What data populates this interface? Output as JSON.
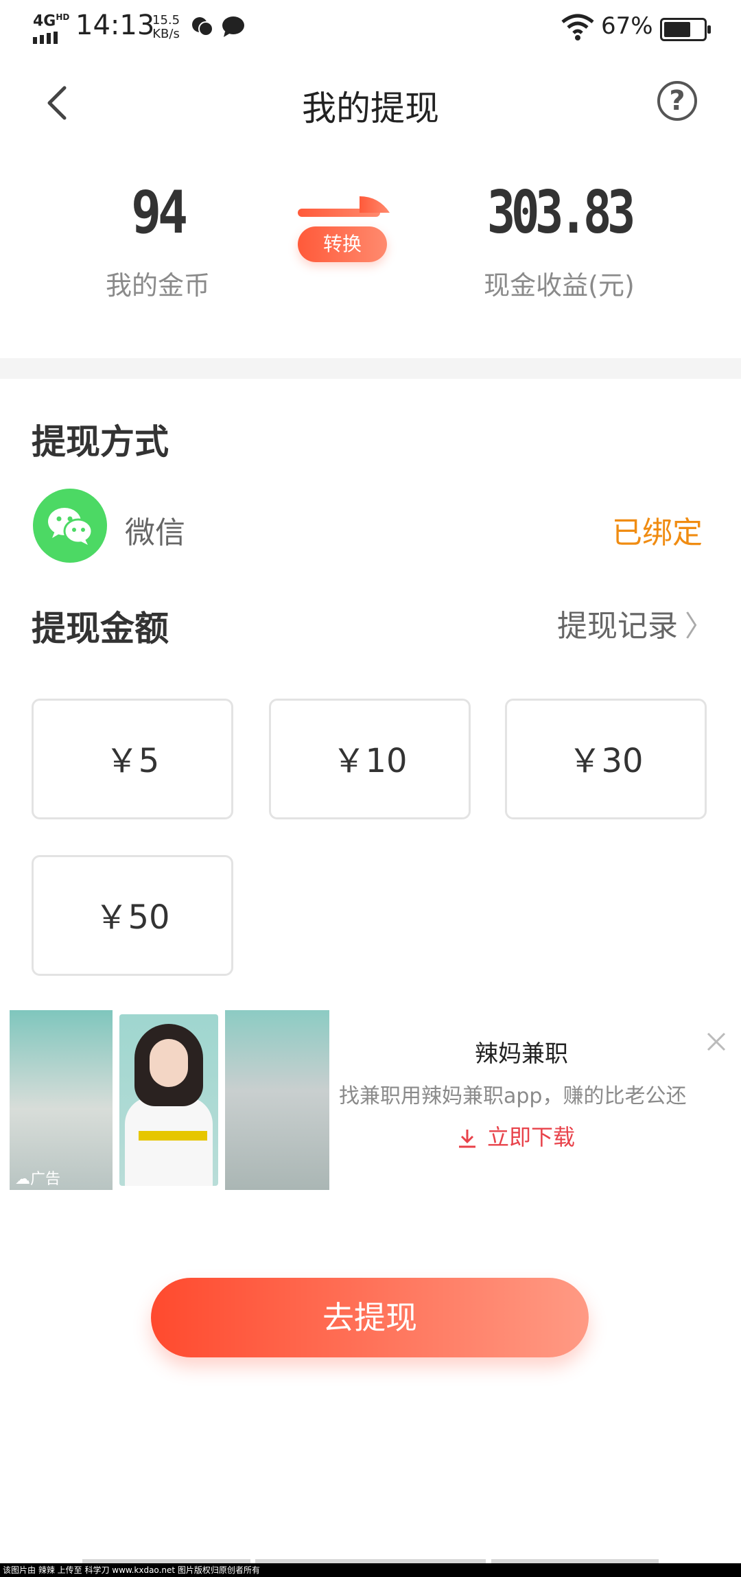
{
  "status_bar": {
    "network": "4G",
    "network_sup": "HD",
    "time": "14:13",
    "speed_value": "15.5",
    "speed_unit": "KB/s",
    "battery_percent": "67%",
    "battery_level": 0.67
  },
  "header": {
    "title": "我的提现",
    "help_label": "?"
  },
  "balance": {
    "coins_value": "94",
    "coins_label": "我的金币",
    "convert_label": "转换",
    "cash_value": "303.83",
    "cash_label": "现金收益(元)"
  },
  "method_section": {
    "title": "提现方式",
    "method_name": "微信",
    "status": "已绑定"
  },
  "amount_section": {
    "title": "提现金额",
    "records_label": "提现记录",
    "records_chevron": "〉",
    "options": [
      "￥5",
      "￥10",
      "￥30",
      "￥50"
    ]
  },
  "ad": {
    "tag": "广告",
    "title": "辣妈兼职",
    "description": "找兼职用辣妈兼职app，赚的比老公还",
    "download_label": "立即下载"
  },
  "withdraw_button": "去提现",
  "watermark": "该图片由 辣辣 上传至 科学刀 www.kxdao.net 图片版权归原创者所有",
  "colors": {
    "accent_orange": "#f08c12",
    "button_red": "#ff4a2e",
    "wechat_green": "#4cd964",
    "download_red": "#e8424a"
  }
}
